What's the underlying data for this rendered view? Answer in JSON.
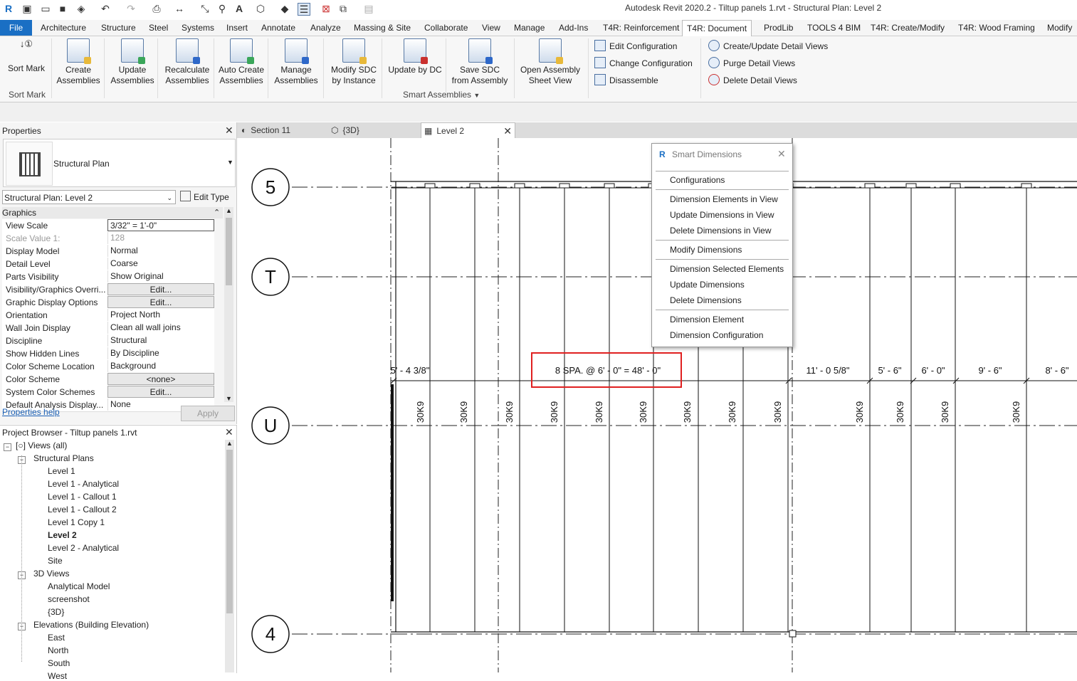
{
  "window": {
    "title": "Autodesk Revit 2020.2 - Tiltup panels 1.rvt - Structural Plan: Level 2"
  },
  "menu": {
    "file": "File",
    "tabs": [
      "Architecture",
      "Structure",
      "Steel",
      "Systems",
      "Insert",
      "Annotate",
      "Analyze",
      "Massing & Site",
      "Collaborate",
      "View",
      "Manage",
      "Add-Ins",
      "T4R: Reinforcement",
      "T4R: Document",
      "ProdLib",
      "TOOLS 4 BIM",
      "T4R: Create/Modify",
      "T4R: Wood Framing",
      "Modify"
    ],
    "active_tab": "T4R: Document"
  },
  "ribbon": {
    "sort_mark": {
      "label": "Sort Mark",
      "panel": "Sort Mark"
    },
    "buttons": [
      {
        "l1": "Create",
        "l2": "Assemblies"
      },
      {
        "l1": "Update",
        "l2": "Assemblies"
      },
      {
        "l1": "Recalculate",
        "l2": "Assemblies"
      },
      {
        "l1": "Auto Create",
        "l2": "Assemblies"
      },
      {
        "l1": "Manage",
        "l2": "Assemblies"
      },
      {
        "l1": "Modify SDC",
        "l2": "by Instance"
      },
      {
        "l1": "Update by DC",
        "l2": ""
      },
      {
        "l1": "Save SDC",
        "l2": "from Assembly"
      },
      {
        "l1": "Open Assembly",
        "l2": "Sheet View"
      }
    ],
    "stack1": [
      "Edit Configuration",
      "Change Configuration",
      "Disassemble"
    ],
    "stack2": [
      "Create/Update Detail Views",
      "Purge Detail Views",
      "Delete Detail Views"
    ],
    "panel_label": "Smart Assemblies"
  },
  "properties": {
    "header": "Properties",
    "type_name": "Structural Plan",
    "view_selector": "Structural Plan: Level 2",
    "edit_type": "Edit Type",
    "group": "Graphics",
    "rows": [
      {
        "k": "View Scale",
        "v": "3/32\" = 1'-0\""
      },
      {
        "k": "Scale Value    1:",
        "v": "128"
      },
      {
        "k": "Display Model",
        "v": "Normal"
      },
      {
        "k": "Detail Level",
        "v": "Coarse"
      },
      {
        "k": "Parts Visibility",
        "v": "Show Original"
      },
      {
        "k": "Visibility/Graphics Overri...",
        "v": "Edit..."
      },
      {
        "k": "Graphic Display Options",
        "v": "Edit..."
      },
      {
        "k": "Orientation",
        "v": "Project North"
      },
      {
        "k": "Wall Join Display",
        "v": "Clean all wall joins"
      },
      {
        "k": "Discipline",
        "v": "Structural"
      },
      {
        "k": "Show Hidden Lines",
        "v": "By Discipline"
      },
      {
        "k": "Color Scheme Location",
        "v": "Background"
      },
      {
        "k": "Color Scheme",
        "v": "<none>"
      },
      {
        "k": "System Color Schemes",
        "v": "Edit..."
      },
      {
        "k": "Default Analysis Display...",
        "v": "None"
      }
    ],
    "help": "Properties help",
    "apply": "Apply"
  },
  "browser": {
    "header": "Project Browser - Tiltup panels 1.rvt",
    "nodes": [
      {
        "t": "Views (all)",
        "lvl": 0,
        "tog": "-"
      },
      {
        "t": "Structural Plans",
        "lvl": 1,
        "tog": "-"
      },
      {
        "t": "Level 1",
        "lvl": 2
      },
      {
        "t": "Level 1 - Analytical",
        "lvl": 2
      },
      {
        "t": "Level 1 - Callout 1",
        "lvl": 2
      },
      {
        "t": "Level 1 - Callout 2",
        "lvl": 2
      },
      {
        "t": "Level 1 Copy 1",
        "lvl": 2
      },
      {
        "t": "Level 2",
        "lvl": 2,
        "bold": true
      },
      {
        "t": "Level 2 - Analytical",
        "lvl": 2
      },
      {
        "t": "Site",
        "lvl": 2
      },
      {
        "t": "3D Views",
        "lvl": 1,
        "tog": "-"
      },
      {
        "t": "Analytical Model",
        "lvl": 2
      },
      {
        "t": "screenshot",
        "lvl": 2
      },
      {
        "t": "{3D}",
        "lvl": 2
      },
      {
        "t": "Elevations (Building Elevation)",
        "lvl": 1,
        "tog": "-"
      },
      {
        "t": "East",
        "lvl": 2
      },
      {
        "t": "North",
        "lvl": 2
      },
      {
        "t": "South",
        "lvl": 2
      },
      {
        "t": "West",
        "lvl": 2
      }
    ]
  },
  "view_tabs": [
    {
      "label": "Section 11"
    },
    {
      "label": "{3D}"
    },
    {
      "label": "Level 2",
      "active": true
    }
  ],
  "smart_dimensions": {
    "title": "Smart Dimensions",
    "groups": [
      [
        "Configurations"
      ],
      [
        "Dimension Elements in View",
        "Update Dimensions in View",
        "Delete Dimensions in View"
      ],
      [
        "Modify Dimensions"
      ],
      [
        "Dimension Selected Elements",
        "Update Dimensions",
        "Delete Dimensions"
      ],
      [
        "Dimension Element",
        "Dimension Configuration"
      ]
    ]
  },
  "drawing": {
    "grid_bubbles": [
      "5",
      "T",
      "U",
      "4"
    ],
    "dimensions": [
      "5' - 4 3/8\"",
      "8 SPA.  @ 6' - 0\" = 48' - 0\"",
      "11' - 0 5/8\"",
      "5' - 6\"",
      "6' - 0\"",
      "9' - 6\"",
      "8' - 6\""
    ],
    "joist_label": "30K9",
    "joist_count": 14
  }
}
